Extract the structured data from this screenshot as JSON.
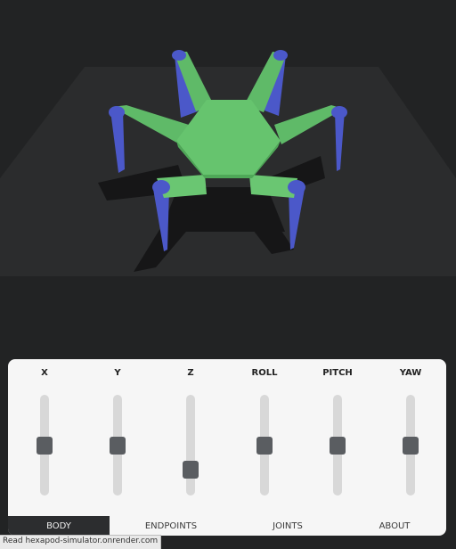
{
  "scene": {
    "floor_color": "#2b2c2d",
    "body_color": "#66c46e",
    "leg_tip_color": "#4b58c9"
  },
  "sliders": [
    {
      "label": "X",
      "value": 0.5
    },
    {
      "label": "Y",
      "value": 0.5
    },
    {
      "label": "Z",
      "value": 0.2
    },
    {
      "label": "ROLL",
      "value": 0.5
    },
    {
      "label": "PITCH",
      "value": 0.5
    },
    {
      "label": "YAW",
      "value": 0.5
    }
  ],
  "tabs": [
    {
      "label": "BODY",
      "active": true
    },
    {
      "label": "ENDPOINTS",
      "active": false
    },
    {
      "label": "JOINTS",
      "active": false
    },
    {
      "label": "ABOUT",
      "active": false
    }
  ],
  "status_bar": "Read hexapod-simulator.onrender.com"
}
